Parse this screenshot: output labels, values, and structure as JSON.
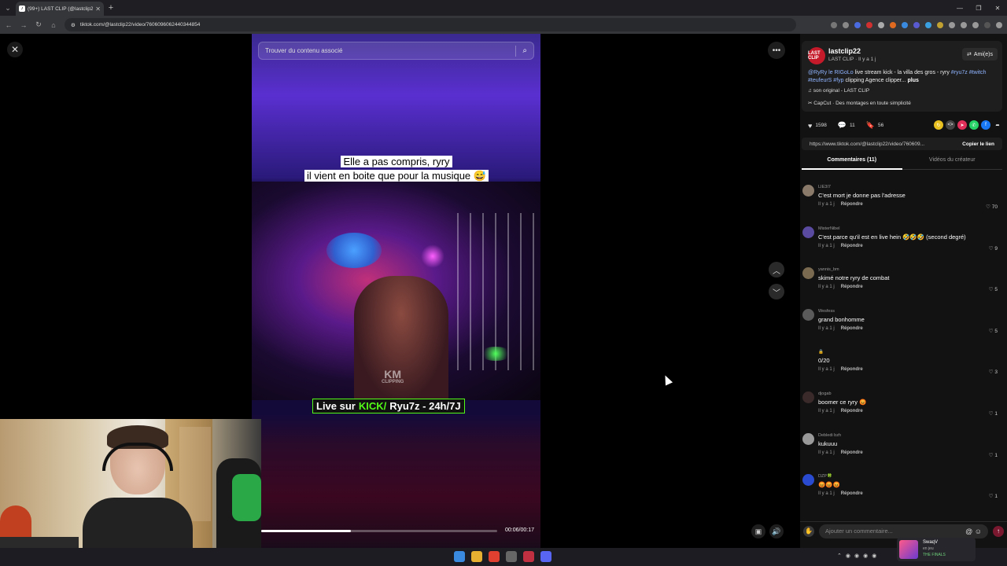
{
  "browser": {
    "tab_title": "(99+) LAST CLIP (@lastclip2",
    "url": "tiktok.com/@lastclip22/video/7606096062440344854"
  },
  "video": {
    "search_placeholder": "Trouver du contenu associé",
    "caption_line1": "Elle a pas compris, ryry",
    "caption_line2": "il vient en boite que pour la musique 😅",
    "live_prefix": "Live sur",
    "live_kick": "KICK/",
    "live_suffix": "Ryu7z - 24h/7J",
    "watermark": "KM",
    "watermark_sub": "CLIPPING",
    "timecode": "00:06/00:17",
    "progress_fraction": 0.38
  },
  "author": {
    "avatar_text": "LAST CLIP",
    "name": "lastclip22",
    "subline": "LAST CLIP · Il y a 1 j",
    "friends_label": "Ami(e)s",
    "desc_mention": "@RyRy le RIGoLo",
    "desc_text": "live stream kick - la villa des gros - ryry",
    "desc_tags": "#ryu7z #twitch #teufeurS #fyp",
    "desc_rest": "clipping Agence clipper...",
    "desc_more": "plus",
    "music": "son original - LAST CLIP",
    "capcut": "CapCut · Des montages en toute simplicité"
  },
  "stats": {
    "likes": "1598",
    "comments": "11",
    "saves": "56"
  },
  "link": {
    "url": "https://www.tiktok.com/@lastclip22/video/760609...",
    "copy_label": "Copier le lien"
  },
  "tabs": {
    "comments": "Commentaires (11)",
    "creator": "Vidéos du créateur"
  },
  "comments": [
    {
      "user": "LIE3I7",
      "text": "C'est mort je donne pas l'adresse",
      "time": "Il y a 1 j",
      "reply": "Répondre",
      "likes": "70",
      "color": "#8a7a6a"
    },
    {
      "user": "MisterNibel",
      "text": "C'est parce qu'il est en live hein 🤣🤣🤣 (second degré)",
      "time": "Il y a 1 j",
      "reply": "Répondre",
      "likes": "9",
      "color": "#5a4aa0"
    },
    {
      "user": "yannis_bm",
      "text": "skimé notre ryry de combat",
      "time": "Il y a 1 j",
      "reply": "Répondre",
      "likes": "5",
      "color": "#7a6a50"
    },
    {
      "user": "Wesfess",
      "text": "grand bonhomme",
      "time": "Il y a 1 j",
      "reply": "Répondre",
      "likes": "5",
      "color": "#5a5a5a"
    },
    {
      "user": "🔒",
      "text": "0/20",
      "time": "Il y a 1 j",
      "reply": "Répondre",
      "likes": "3",
      "color": "#121212"
    },
    {
      "user": "djogab",
      "text": "boomer ce ryry 😡",
      "time": "Il y a 1 j",
      "reply": "Répondre",
      "likes": "1",
      "color": "#3a2a2a"
    },
    {
      "user": "Debledi bzh",
      "text": "kukuuu",
      "time": "Il y a 1 j",
      "reply": "Répondre",
      "likes": "1",
      "color": "#9a9a9a"
    },
    {
      "user": "DZP🍀",
      "text": "😡😡😡",
      "time": "Il y a 1 j",
      "reply": "Répondre",
      "likes": "1",
      "color": "#2a4ad0"
    }
  ],
  "add_comment": {
    "placeholder": "Ajouter un commentaire..."
  },
  "notification": {
    "name": "SwaqV",
    "status": "en jeu",
    "game": "THE FINALS"
  },
  "colors": {
    "kick_green": "#53fc18",
    "hashtag_blue": "#8fb4ff",
    "post_red": "#7a1830"
  }
}
